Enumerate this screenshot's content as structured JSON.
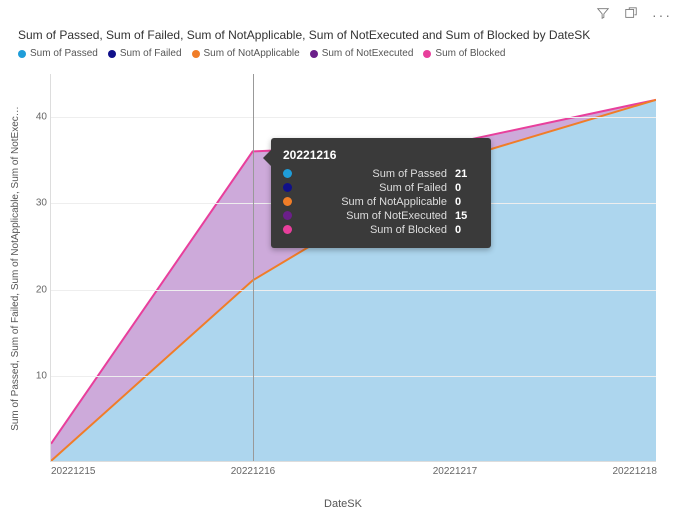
{
  "toolbar": {
    "filter_icon": "filter",
    "focus_icon": "focus",
    "more_icon": "more"
  },
  "title": "Sum of Passed, Sum of Failed, Sum of NotApplicable, Sum of NotExecuted and Sum of Blocked by DateSK",
  "legend": [
    {
      "name": "Sum of Passed",
      "color": "#1f9dd9"
    },
    {
      "name": "Sum of Failed",
      "color": "#10108a"
    },
    {
      "name": "Sum of NotApplicable",
      "color": "#f07d28"
    },
    {
      "name": "Sum of NotExecuted",
      "color": "#6b1f8a"
    },
    {
      "name": "Sum of Blocked",
      "color": "#e83f9c"
    }
  ],
  "ylabel": "Sum of Passed, Sum of Failed, Sum of NotApplicable, Sum of NotExec…",
  "xlabel": "DateSK",
  "yticks": [
    "10",
    "20",
    "30",
    "40"
  ],
  "xticks": [
    "20221215",
    "20221216",
    "20221217",
    "20221218"
  ],
  "tooltip": {
    "header": "20221216",
    "rows": [
      {
        "label": "Sum of Passed",
        "value": "21",
        "color": "#1f9dd9"
      },
      {
        "label": "Sum of Failed",
        "value": "0",
        "color": "#10108a"
      },
      {
        "label": "Sum of NotApplicable",
        "value": "0",
        "color": "#f07d28"
      },
      {
        "label": "Sum of NotExecuted",
        "value": "15",
        "color": "#6b1f8a"
      },
      {
        "label": "Sum of Blocked",
        "value": "0",
        "color": "#e83f9c"
      }
    ]
  },
  "chart_data": {
    "type": "area",
    "stacked": true,
    "categories": [
      "20221215",
      "20221216",
      "20221217",
      "20221218"
    ],
    "series": [
      {
        "name": "Sum of Passed",
        "values": [
          0,
          21,
          35,
          42
        ],
        "color": "#9fcfeb"
      },
      {
        "name": "Sum of Failed",
        "values": [
          0,
          0,
          0,
          0
        ],
        "color": "#10108a"
      },
      {
        "name": "Sum of NotApplicable",
        "values": [
          0,
          0,
          0,
          0
        ],
        "color": "#f07d28"
      },
      {
        "name": "Sum of NotExecuted",
        "values": [
          2,
          15,
          2,
          0
        ],
        "color": "#c49bd4"
      },
      {
        "name": "Sum of Blocked",
        "values": [
          0,
          0,
          0,
          0
        ],
        "color": "#e83f9c"
      }
    ],
    "xlabel": "DateSK",
    "ylabel": "Sum of Passed, Sum of Failed, Sum of NotApplicable, Sum of NotExecuted and Sum of Blocked",
    "ylim": [
      0,
      45
    ],
    "yticks": [
      10,
      20,
      30,
      40
    ],
    "title": "Sum of Passed, Sum of Failed, Sum of NotApplicable, Sum of NotExecuted and Sum of Blocked by DateSK"
  }
}
